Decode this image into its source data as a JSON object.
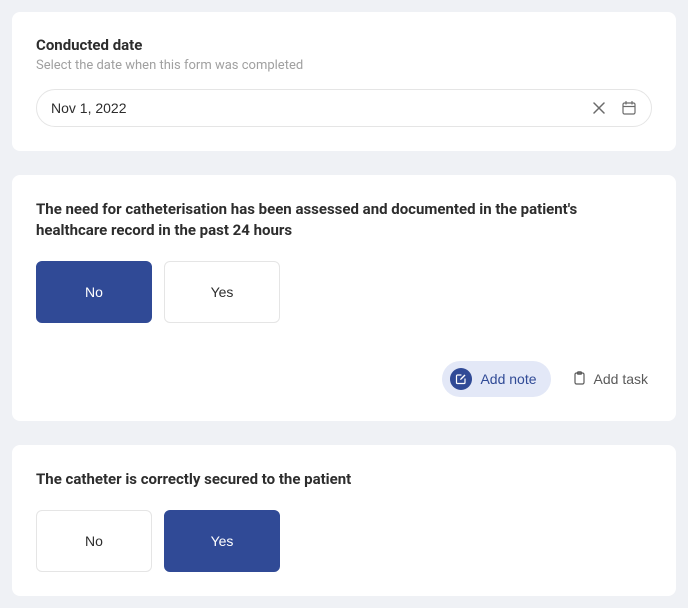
{
  "card1": {
    "title": "Conducted date",
    "subtitle": "Select the date when this form was completed",
    "dateValue": "Nov 1, 2022"
  },
  "card2": {
    "question": "The need for catheterisation has been assessed and documented in the patient's healthcare record in the past 24 hours",
    "noLabel": "No",
    "yesLabel": "Yes",
    "addNoteLabel": "Add note",
    "addTaskLabel": "Add task"
  },
  "card3": {
    "question": "The catheter is correctly secured to the patient",
    "noLabel": "No",
    "yesLabel": "Yes"
  }
}
